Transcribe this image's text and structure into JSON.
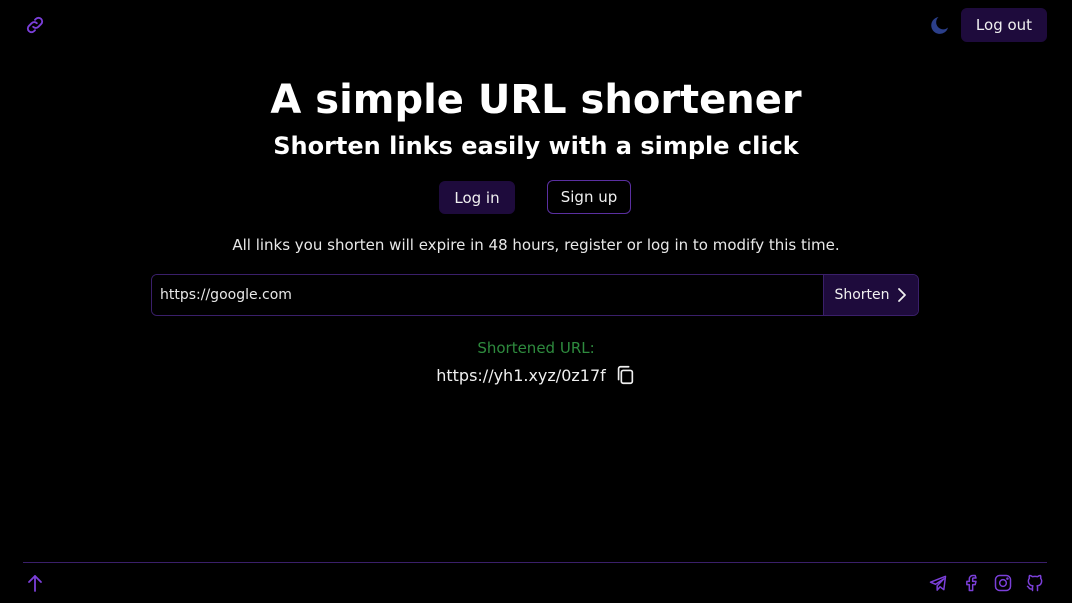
{
  "header": {
    "logo_icon": "link-icon",
    "theme_icon": "moon-icon",
    "logout_label": "Log out"
  },
  "hero": {
    "title": "A simple URL shortener",
    "subtitle": "Shorten links easily with a simple click"
  },
  "auth": {
    "login_label": "Log in",
    "signup_label": "Sign up"
  },
  "info_text": "All links you shorten will expire in 48 hours, register or log in to modify this time.",
  "shortener": {
    "input_value": "https://google.com",
    "button_label": "Shorten",
    "button_icon": "chevron-right-icon"
  },
  "result": {
    "label": "Shortened URL:",
    "url": "https://yh1.xyz/0z17f",
    "copy_icon": "copy-icon"
  },
  "footer": {
    "scroll_icon": "arrow-up-icon",
    "social_icons": [
      "telegram-icon",
      "facebook-icon",
      "instagram-icon",
      "github-icon"
    ]
  },
  "colors": {
    "background": "#000000",
    "accent": "#7b3fd9",
    "button_fill": "#1e0b3c",
    "success": "#2e8b3e",
    "moon": "#2b3f8a"
  }
}
